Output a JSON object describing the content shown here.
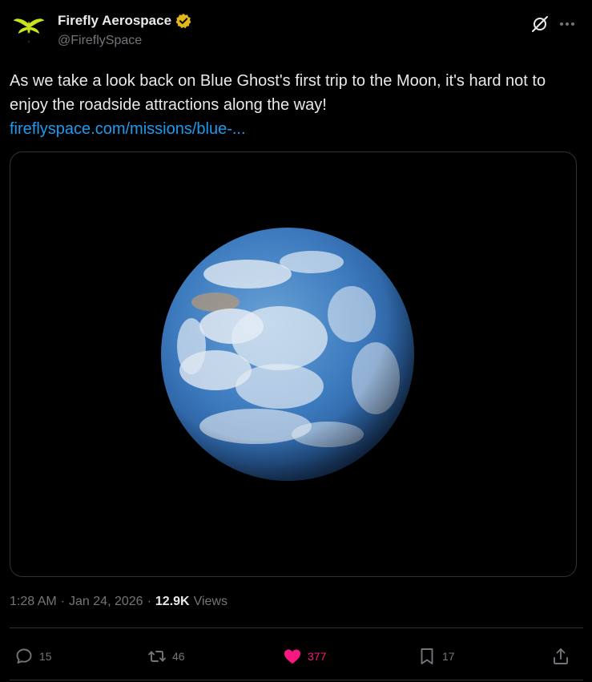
{
  "author": {
    "display_name": "Firefly Aerospace",
    "handle": "@FireflySpace",
    "verified_badge": "gold-verified-badge",
    "avatar_icon": "firefly-logo"
  },
  "post": {
    "text": "As we take a look back on Blue Ghost's first trip to the Moon, it's hard not to enjoy the roadside attractions along the way!",
    "link_text": "fireflyspace.com/missions/blue-...",
    "media_icon": "earth-image"
  },
  "meta": {
    "time": "1:28 AM",
    "date": "Jan 24, 2026",
    "views_count": "12.9K",
    "views_label": "Views",
    "separator": "·"
  },
  "actions": {
    "replies": "15",
    "reposts": "46",
    "likes": "377",
    "bookmarks": "17"
  },
  "colors": {
    "accent_link": "#1d9bf0",
    "like": "#f91880",
    "badge_gold": "#e2b719",
    "logo_green": "#c8e41a",
    "muted": "#71767b"
  }
}
